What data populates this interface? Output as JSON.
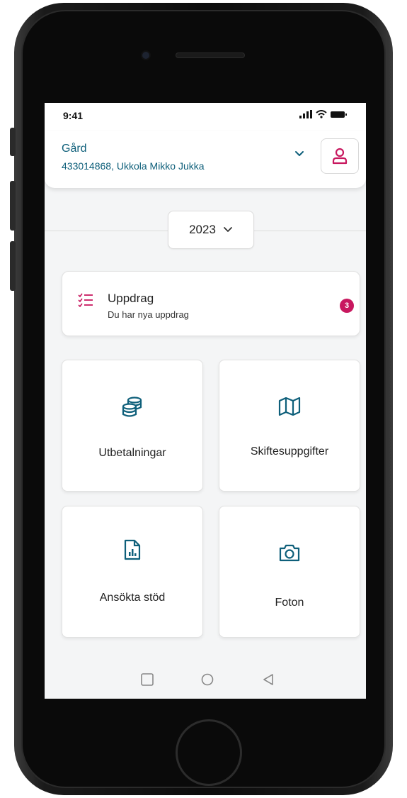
{
  "status": {
    "time": "9:41",
    "icons": [
      "signal-icon",
      "wifi-icon",
      "battery-icon"
    ]
  },
  "header": {
    "farm_label": "Gård",
    "farm_id": "433014868, Ukkola Mikko Jukka",
    "dropdown_icon": "chevron-down-icon",
    "profile_icon": "user-icon"
  },
  "year_selector": {
    "value": "2023",
    "icon": "chevron-down-icon"
  },
  "tasks": {
    "title": "Uppdrag",
    "subtitle": "Du har nya uppdrag",
    "badge": "3",
    "icon": "checklist-icon"
  },
  "tiles": [
    {
      "label": "Utbetalningar",
      "icon": "coins-icon"
    },
    {
      "label": "Skiftesuppgifter",
      "icon": "map-icon"
    },
    {
      "label": "Ansökta stöd",
      "icon": "document-chart-icon"
    },
    {
      "label": "Foton",
      "icon": "camera-icon"
    }
  ],
  "nav": {
    "icons": [
      "square-nav-icon",
      "circle-nav-icon",
      "back-triangle-icon"
    ]
  },
  "colors": {
    "accent": "#c8185f",
    "primary": "#0e5f7a",
    "background": "#f4f5f6"
  }
}
